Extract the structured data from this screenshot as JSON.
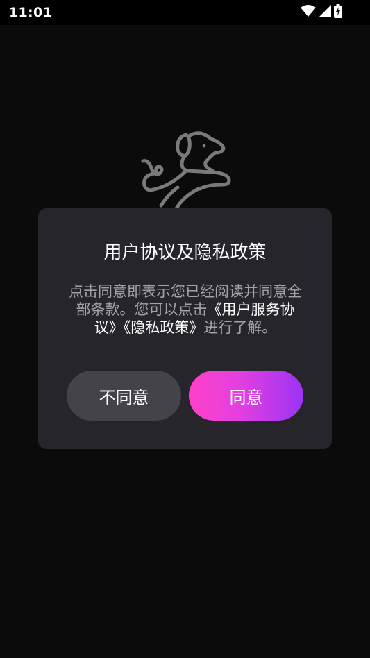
{
  "status_bar": {
    "time": "11:01",
    "icons": [
      "wifi-icon",
      "cellular-signal-icon",
      "battery-charging-icon"
    ]
  },
  "logo": {
    "icon": "dog-logo-icon",
    "color": "#7a7a7a"
  },
  "dialog": {
    "title": "用户协议及隐私政策",
    "body": {
      "intro": "点击同意即表示您已经阅读并同意全部条款。您可以点击",
      "user_agreement_link": "《用户服务协议》",
      "privacy_link": "《隐私政策》",
      "outro": "进行了解。"
    },
    "decline_label": "不同意",
    "agree_label": "同意"
  },
  "colors": {
    "background": "#0b0b0b",
    "dialog_background": "#25252b",
    "decline_button": "#434349",
    "agree_gradient_start": "#ff40c8",
    "agree_gradient_end": "#9b34f5",
    "body_text": "#a3a3a8",
    "link_text": "#ffffff"
  }
}
